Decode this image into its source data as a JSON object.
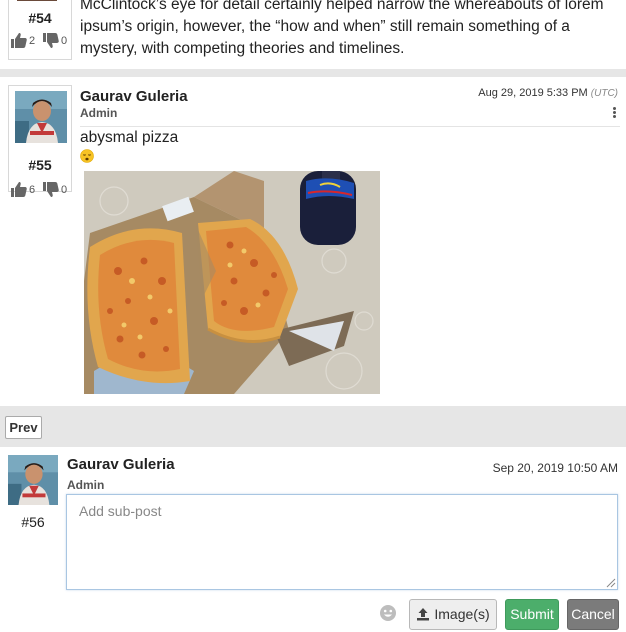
{
  "post54": {
    "number": "#54",
    "body": "McClintock’s eye for detail certainly helped narrow the whereabouts of lorem ipsum’s origin, however, the “how and when” still remain something of a mystery, with competing theories and timelines.",
    "likes": "2",
    "dislikes": "0"
  },
  "post55": {
    "number": "#55",
    "author": "Gaurav Guleria",
    "role": "Admin",
    "date": "Aug 29, 2019 5:33 PM",
    "tz": "(UTC)",
    "body": "abysmal pizza",
    "emoji": "sleepy-face-emoji",
    "likes": "6",
    "dislikes": "0",
    "image": "pizza-photo"
  },
  "pager": {
    "prev_label": "Prev"
  },
  "composer": {
    "number": "#56",
    "author": "Gaurav Guleria",
    "role": "Admin",
    "date": "Sep 20, 2019 10:50 AM",
    "placeholder": "Add sub-post",
    "value": "",
    "image_button": "Image(s)",
    "submit_button": "Submit",
    "cancel_button": "Cancel"
  },
  "colors": {
    "submit": "#4cae6b",
    "cancel": "#7b7b7b",
    "separator": "#e6e6e6"
  },
  "icons": [
    "thumbs-up-icon",
    "thumbs-down-icon",
    "kebab-menu-icon",
    "emoji-picker-icon",
    "upload-icon",
    "textarea-resize-icon"
  ]
}
